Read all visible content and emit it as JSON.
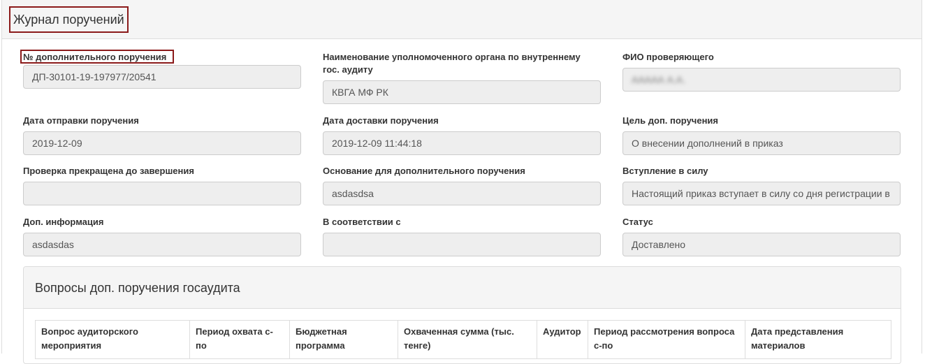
{
  "header": {
    "title": "Журнал поручений"
  },
  "fields": [
    {
      "label": "№ дополнительного поручения",
      "value": "ДП-30101-19-197977/20541"
    },
    {
      "label": "Наименование уполномоченного органа по внутреннему гос. аудиту",
      "value": "КВГА МФ РК"
    },
    {
      "label": "ФИО проверяющего",
      "value": "ААААА А.А."
    },
    {
      "label": "Дата отправки поручения",
      "value": "2019-12-09"
    },
    {
      "label": "Дата доставки поручения",
      "value": "2019-12-09 11:44:18"
    },
    {
      "label": "Цель доп. поручения",
      "value": "О внесении дополнений в приказ"
    },
    {
      "label": "Проверка прекращена до завершения",
      "value": ""
    },
    {
      "label": "Основание для дополнительного поручения",
      "value": "asdasdsa"
    },
    {
      "label": "Вступление в силу",
      "value": "Настоящий приказ вступает в силу со дня регистрации в"
    },
    {
      "label": "Доп. информация",
      "value": "asdasdas"
    },
    {
      "label": "В соответствии с",
      "value": ""
    },
    {
      "label": "Статус",
      "value": "Доставлено"
    }
  ],
  "questions_panel": {
    "title": "Вопросы доп. поручения госаудита",
    "columns": [
      "Вопрос аудиторского мероприятия",
      "Период охвата с-по",
      "Бюджетная программа",
      "Охваченная сумма (тыс. тенге)",
      "Аудитор",
      "Период рассмотрения вопроса с-по",
      "Дата представления материалов"
    ]
  }
}
